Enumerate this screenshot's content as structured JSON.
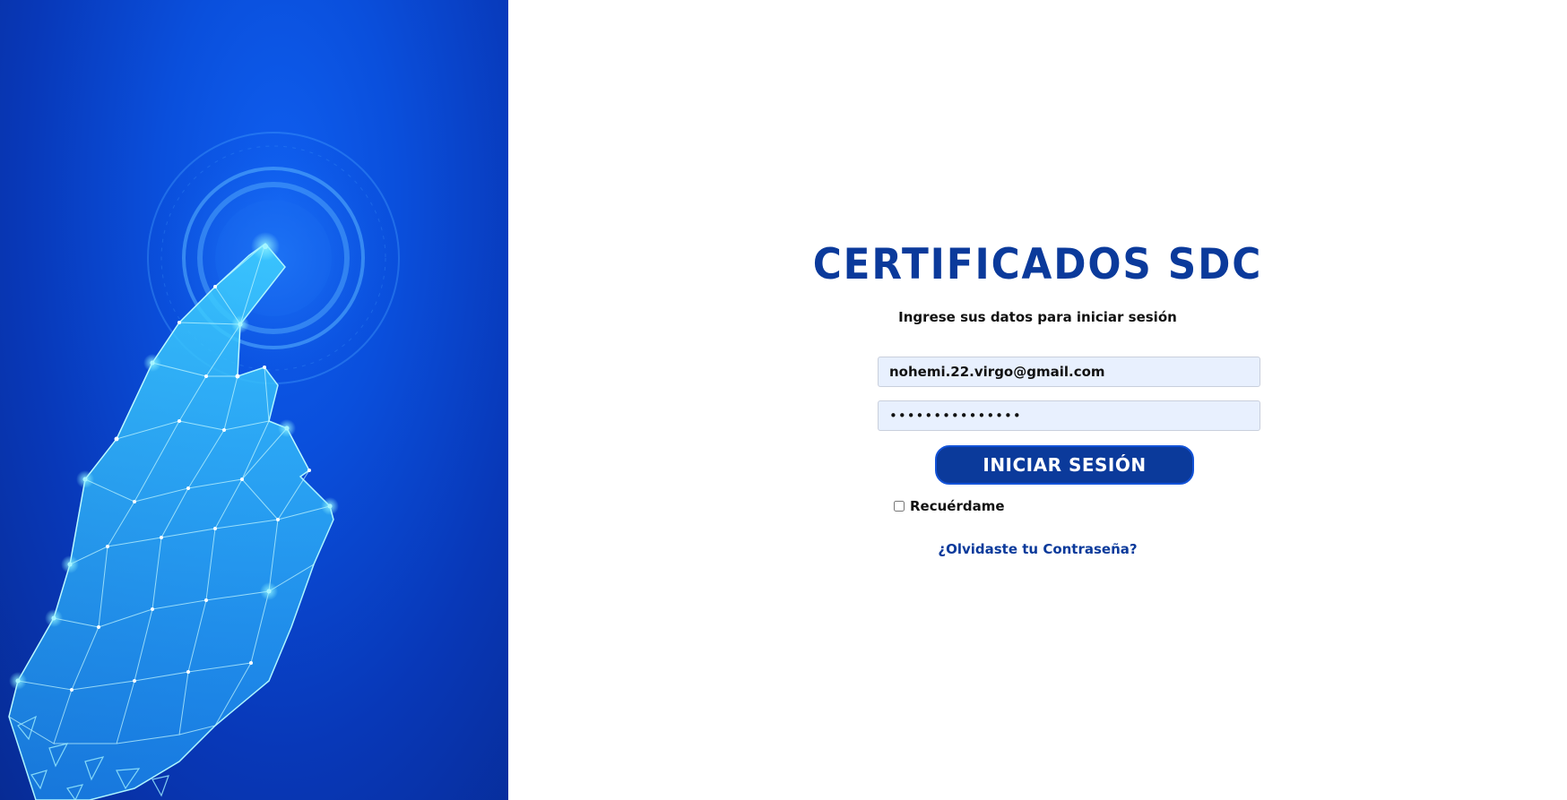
{
  "hero": {
    "image_name": "digital-hand-touch-illustration"
  },
  "login": {
    "title": "CERTIFICADOS SDC",
    "subtitle": "Ingrese sus datos para iniciar sesión",
    "email_value": "nohemi.22.virgo@gmail.com",
    "password_value": "•••••••••••••••",
    "submit_label": "INICIAR SESIÓN",
    "remember_label": "Recuérdame",
    "remember_checked": false,
    "forgot_label": "¿Olvidaste tu Contraseña?"
  },
  "colors": {
    "brand_blue": "#0b3a9b",
    "button_border": "#1353d8",
    "input_bg": "#e8f0fe",
    "hero_blue": "#0a4fdc"
  }
}
